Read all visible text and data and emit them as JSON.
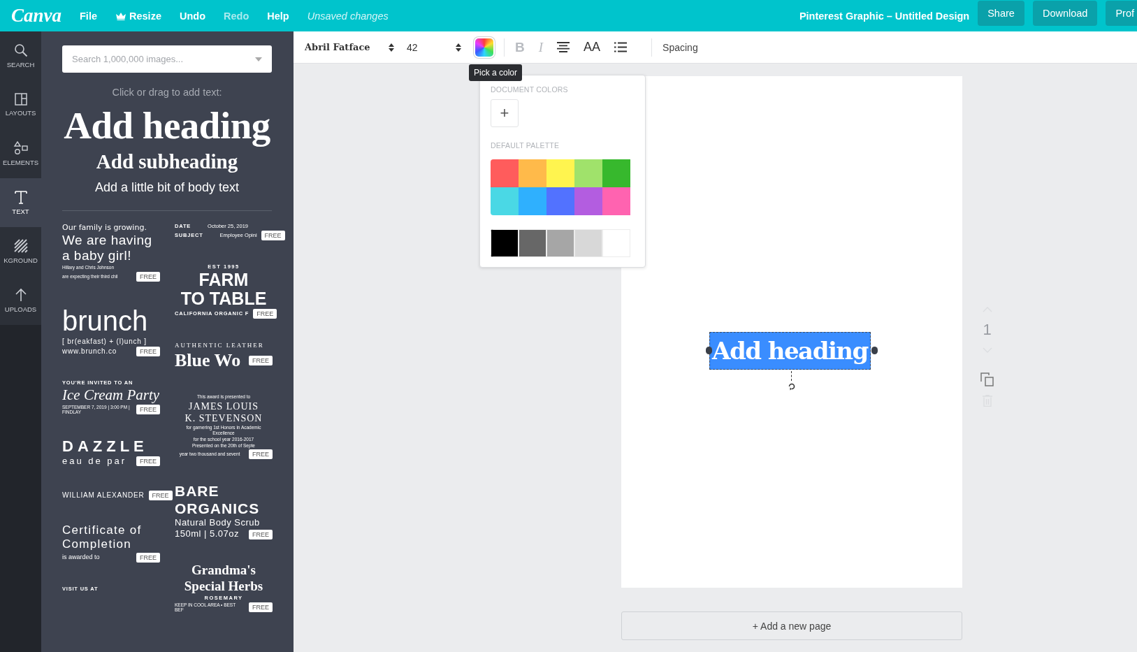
{
  "topbar": {
    "logo": "Canva",
    "menu": [
      {
        "label": "File",
        "kind": "plain",
        "disabled": false
      },
      {
        "label": "Resize",
        "kind": "crown",
        "disabled": false
      },
      {
        "label": "Undo",
        "kind": "plain",
        "disabled": false
      },
      {
        "label": "Redo",
        "kind": "plain",
        "disabled": true
      },
      {
        "label": "Help",
        "kind": "plain",
        "disabled": false
      }
    ],
    "status": "Unsaved changes",
    "title": "Pinterest Graphic – Untitled Design",
    "buttons": [
      "Share",
      "Download",
      "Prof"
    ]
  },
  "nav": [
    {
      "label": "SEARCH",
      "kind": "search",
      "selected": false
    },
    {
      "label": "LAYOUTS",
      "kind": "layouts",
      "selected": false
    },
    {
      "label": "ELEMENTS",
      "kind": "elements",
      "selected": false
    },
    {
      "label": "TEXT",
      "kind": "text",
      "selected": true
    },
    {
      "label": "KGROUND",
      "kind": "background",
      "selected": false
    },
    {
      "label": "UPLOADS",
      "kind": "uploads",
      "selected": false
    }
  ],
  "panel": {
    "search": {
      "placeholder": "Search 1,000,000 images..."
    },
    "hint": "Click or drag to add text:",
    "heading": "Add heading",
    "subheading": "Add subheading",
    "body": "Add a little bit of body text",
    "templates": [
      [
        {
          "badge": "FREE",
          "lines": [
            {
              "text": "Our family is growing.",
              "kind": "hand-sm"
            },
            {
              "text": "We are having",
              "kind": "hand-lg"
            },
            {
              "text": "a baby girl!",
              "kind": "hand-lg"
            },
            {
              "text": "Hillary and Chris Johnson",
              "kind": "fine"
            },
            {
              "text": "are expecting their third chil",
              "kind": "fine"
            }
          ]
        },
        {
          "badge": "FREE",
          "lines": [
            {
              "text": "brunch",
              "kind": "sans-xl"
            },
            {
              "text": "[ br(eakfast) + (l)unch ]",
              "kind": "sans-sm"
            },
            {
              "text": "www.brunch.co",
              "kind": "sans-sm"
            }
          ]
        },
        {
          "badge": "FREE",
          "lines": [
            {
              "text": "YOU'RE INVITED TO AN",
              "kind": "label-caps"
            },
            {
              "text": "Ice Cream Party",
              "kind": "script-lg"
            },
            {
              "text": "SEPTEMBER 7, 2019 | 3:00 PM | FINDLAY",
              "kind": "fine"
            }
          ]
        },
        {
          "badge": "FREE",
          "lines": [
            {
              "text": "DAZZLE",
              "kind": "caps-wide"
            },
            {
              "text": "eau de par",
              "kind": "wide-light"
            }
          ]
        },
        {
          "badge": "FREE",
          "lines": [
            {
              "text": "WILLIAM ALEXANDER",
              "kind": "condensed"
            }
          ]
        },
        {
          "badge": "FREE",
          "lines": [
            {
              "text": "Certificate of",
              "kind": "light-lg"
            },
            {
              "text": "Completion",
              "kind": "light-lg"
            },
            {
              "text": "is awarded to",
              "kind": "fine-lg"
            }
          ]
        },
        {
          "lines": [
            {
              "text": "VISIT US AT",
              "kind": "label-caps"
            }
          ]
        }
      ],
      [
        {
          "badge": "FREE",
          "lines": [
            {
              "text": "DATE",
              "kind": "label-caps",
              "detail": "October 25, 2019"
            },
            {
              "text": "SUBJECT",
              "kind": "label-caps",
              "detail": "Employee Opini"
            }
          ]
        },
        {
          "badge": "FREE",
          "lines": [
            {
              "text": "EST 1995",
              "kind": "label-caps-c"
            },
            {
              "text": "FARM",
              "kind": "block-xl"
            },
            {
              "text": "TO TABLE",
              "kind": "block-xl"
            },
            {
              "text": "CALIFORNIA ORGANIC F",
              "kind": "label-caps"
            }
          ]
        },
        {
          "badge": "FREE",
          "lines": [
            {
              "text": "AUTHENTIC LEATHER",
              "kind": "serif-caps-sm"
            },
            {
              "text": "Blue Wo",
              "kind": "serif-display"
            }
          ]
        },
        {
          "badge": "FREE",
          "lines": [
            {
              "text": "This award is presented to",
              "kind": "fine-c"
            },
            {
              "text": "JAMES LOUIS",
              "kind": "serif-md"
            },
            {
              "text": "K. STEVENSON",
              "kind": "serif-md"
            },
            {
              "text": "for garnering 1st Honors in Academic Excellence",
              "kind": "fine-c"
            },
            {
              "text": "for the school year 2016-2017",
              "kind": "fine-c"
            },
            {
              "text": "Presented on the 20th of Septe",
              "kind": "fine-c"
            },
            {
              "text": "year two thousand and sevent",
              "kind": "fine-c"
            }
          ]
        },
        {
          "badge": "FREE",
          "lines": [
            {
              "text": "BARE",
              "kind": "sans-lg-bold"
            },
            {
              "text": "ORGANICS",
              "kind": "sans-lg-bold"
            },
            {
              "text": "Natural Body Scrub",
              "kind": "sans-md"
            },
            {
              "text": "150ml | 5.07oz",
              "kind": "sans-md"
            }
          ]
        },
        {
          "badge": "FREE",
          "lines": [
            {
              "text": "Grandma's",
              "kind": "serif-lg"
            },
            {
              "text": "Special Herbs",
              "kind": "serif-lg"
            },
            {
              "text": "ROSEMARY",
              "kind": "label-caps-c"
            },
            {
              "text": "KEEP IN COOL AREA • BEST BEF",
              "kind": "fine"
            }
          ]
        }
      ]
    ]
  },
  "toolbar": {
    "font": "Abril Fatface",
    "size": "42",
    "tools": [
      {
        "kind": "color",
        "tooltip": "Pick a color"
      },
      {
        "kind": "divider"
      },
      {
        "kind": "bold",
        "label": "B",
        "disabled": true
      },
      {
        "kind": "italic",
        "label": "I",
        "disabled": true
      },
      {
        "kind": "align",
        "disabled": false
      },
      {
        "kind": "caps",
        "label": "AA",
        "disabled": false
      },
      {
        "kind": "list",
        "disabled": false
      },
      {
        "kind": "divider"
      },
      {
        "kind": "label",
        "label": "Spacing"
      }
    ]
  },
  "color_picker": {
    "document_title": "DOCUMENT COLORS",
    "add": "+",
    "palette_title": "DEFAULT PALETTE",
    "palette": [
      [
        {
          "color": "#ff5c5c"
        },
        {
          "color": "#ffba4a"
        },
        {
          "color": "#fff44f"
        },
        {
          "color": "#a0e26b"
        },
        {
          "color": "#37b82d"
        }
      ],
      [
        {
          "color": "#4ad8e5"
        },
        {
          "color": "#2fb0fe"
        },
        {
          "color": "#5272ff"
        },
        {
          "color": "#b35de0"
        },
        {
          "color": "#ff63b0"
        }
      ]
    ],
    "grays": [
      {
        "color": "#000000"
      },
      {
        "color": "#676767"
      },
      {
        "color": "#a6a6a6"
      },
      {
        "color": "#d8d8d8"
      },
      {
        "color": "#ffffff"
      }
    ]
  },
  "canvas": {
    "element": {
      "text": "Add heading",
      "selected": true
    },
    "page_number": "1",
    "add_page": "+ Add a new page"
  }
}
